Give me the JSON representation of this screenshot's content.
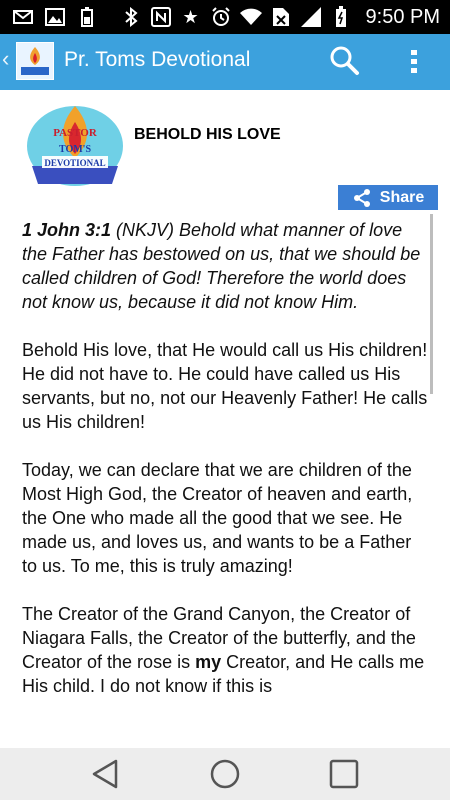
{
  "status_bar": {
    "time": "9:50 PM",
    "icons": [
      "mail-icon",
      "image-icon",
      "battery-small-icon",
      "bluetooth-icon",
      "nfc-icon",
      "star-icon",
      "alarm-icon",
      "wifi-icon",
      "no-sim-icon",
      "signal-icon",
      "battery-icon"
    ]
  },
  "app_bar": {
    "title": "Pr. Toms Devotional",
    "color": "#3ca1dd"
  },
  "logo": {
    "line1": "PASTOR",
    "line2": "TOM'S",
    "line3": "DEVOTIONAL"
  },
  "post": {
    "title": "BEHOLD HIS LOVE",
    "share_label": "Share",
    "scripture_ref": "1 John 3:1",
    "scripture_text": " (NKJV) Behold what manner of love the Father has bestowed on us, that we should be called children of God! Therefore the world does not know us, because it did not know Him.",
    "paragraph2": "Behold His love, that He would call us His children!  He did not have to.  He could have called us His servants, but no, not our Heavenly Father!  He calls us His children!",
    "paragraph3": "Today, we can declare that we are children of the Most High God, the Creator of heaven and earth, the One who made all the good that we see.  He made us, and loves us, and wants to be a Father to us.  To me, this is truly amazing!",
    "paragraph4_a": "The Creator of the Grand Canyon, the Creator of Niagara Falls, the Creator of the butterfly, and the Creator of the rose is ",
    "paragraph4_bold": "my",
    "paragraph4_b": " Creator, and He calls me His child.  I do not know if this is"
  },
  "nav_bar": {
    "buttons": [
      "back-icon",
      "home-icon",
      "recents-icon"
    ]
  }
}
